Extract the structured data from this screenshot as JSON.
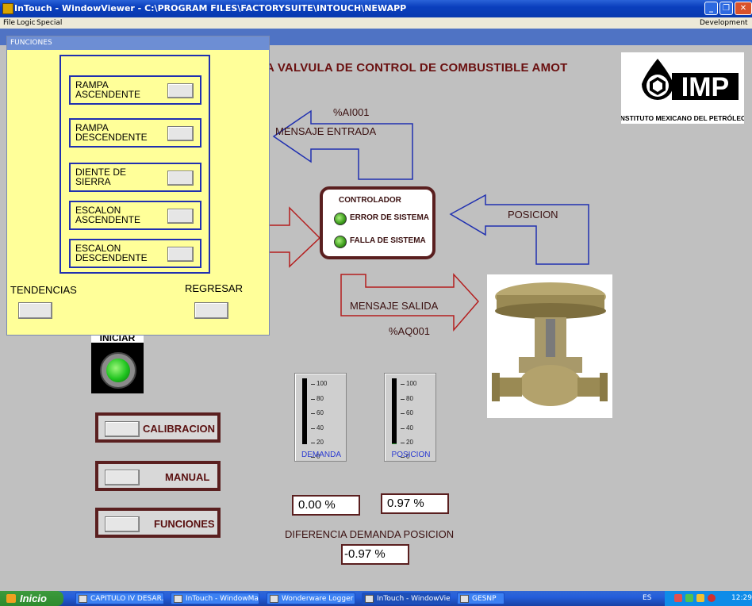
{
  "window": {
    "title": "InTouch - WindowViewer - C:\\PROGRAM FILES\\FACTORYSUITE\\INTOUCH\\NEWAPP",
    "controls": [
      "_",
      "❐",
      "✕"
    ]
  },
  "menu": {
    "items": [
      "File",
      "Logic",
      "Special"
    ],
    "right_label": "Development"
  },
  "hmi": {
    "title": "A VALVULA DE CONTROL DE COMBUSTIBLE AMOT",
    "logo_text": "INSTITUTO MEXICANO DEL PETRÓLEO",
    "logo_letters": "IMP",
    "tag_input": "%AI001",
    "msg_input": "MENSAJE  ENTRADA",
    "controller_title": "CONTROLADOR",
    "error_label": "ERROR DE SISTEMA",
    "fault_label": "FALLA DE SISTEMA",
    "position_label": "POSICION",
    "msg_output": "MENSAJE  SALIDA",
    "tag_output": "%AQ001",
    "iniciar_label": "INICIAR",
    "buttons": {
      "calibracion": "CALIBRACION",
      "manual": "MANUAL",
      "funciones": "FUNCIONES"
    },
    "gauges": {
      "ticks": [
        "100",
        "80",
        "60",
        "40",
        "20",
        "0"
      ],
      "demanda_label": "DEMANDA",
      "posicion_label": "POSICION",
      "demanda_percent": 0.0,
      "posicion_percent": 0.97
    },
    "values": {
      "demanda": "0.00 %",
      "posicion": "0.97  %",
      "diff_label": "DIFERENCIA DEMANDA POSICION",
      "diff": "-0.97 %"
    }
  },
  "funciones_panel": {
    "title": "FUNCIONES",
    "items": [
      {
        "line1": "RAMPA",
        "line2": "ASCENDENTE"
      },
      {
        "line1": "RAMPA",
        "line2": "DESCENDENTE"
      },
      {
        "line1": "DIENTE DE",
        "line2": "SIERRA"
      },
      {
        "line1": "ESCALON",
        "line2": "ASCENDENTE"
      },
      {
        "line1": "ESCALON",
        "line2": "DESCENDENTE"
      }
    ],
    "tendencias": "TENDENCIAS",
    "regresar": "REGRESAR"
  },
  "taskbar": {
    "start": "Inicio",
    "tasks": [
      "CAPITULO IV DESAR...",
      "InTouch - WindowMa...",
      "Wonderware Logger ...",
      "InTouch - WindowVie...",
      "GESNP"
    ],
    "lang": "ES",
    "clock": "12:29"
  },
  "colors": {
    "panel_yellow": "#ffff99",
    "dark_red_frame": "#5a1f1f",
    "arrow_red": "#b41e1e",
    "arrow_blue": "#2030b0",
    "lamp_green": "#3a9a1a"
  }
}
